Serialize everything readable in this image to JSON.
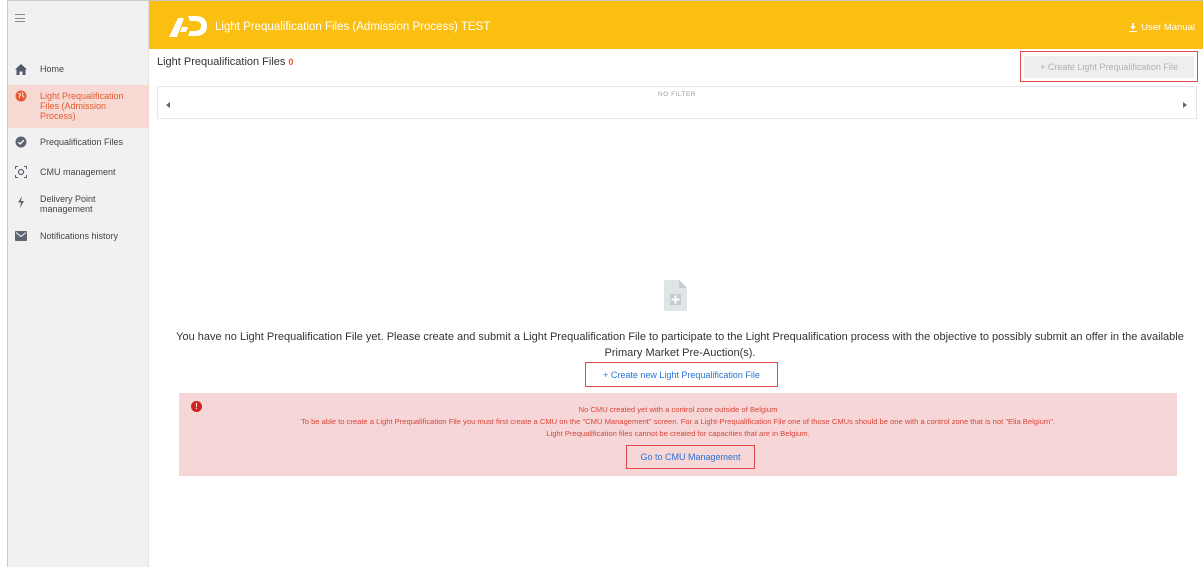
{
  "sidebar": {
    "items": [
      {
        "label": "Home",
        "icon": "home-icon",
        "active": false
      },
      {
        "label": "Light Prequalification Files (Admission Process)",
        "icon": "globe-icon",
        "active": true
      },
      {
        "label": "Prequalification Files",
        "icon": "check-badge-icon",
        "active": false
      },
      {
        "label": "CMU management",
        "icon": "target-icon",
        "active": false
      },
      {
        "label": "Delivery Point management",
        "icon": "lightning-icon",
        "active": false
      },
      {
        "label": "Notifications history",
        "icon": "envelope-icon",
        "active": false
      }
    ]
  },
  "header": {
    "title": "Light Prequalification Files (Admission Process) TEST",
    "user_manual": "User Manual",
    "brand_color": "#fbbf12"
  },
  "main": {
    "page_title": "Light Prequalification Files",
    "count": "0",
    "create_top_button": "+ Create Light Prequalification File",
    "filter_label": "NO FILTER",
    "empty_message": "You have no Light Prequalification File yet. Please create and submit a Light Prequalification File to participate to the Light Prequalification process with the objective to possibly submit an offer in the available Primary Market Pre-Auction(s).",
    "create_new_button": "+ Create new Light Prequalification File"
  },
  "alert": {
    "line1": "No CMU created yet with a control zone outside of Belgium",
    "line2": "To be able to create a Light Prequalification File you must first create a CMU on the \"CMU Management\" screen. For a Light-Prequalification File one of those CMUs should be one with a control zone that is not \"Elia Belgium\".",
    "line3": "Light Prequalification files cannot be created for capacities that are in Belgium.",
    "button": "Go to CMU Management",
    "icon_glyph": "!",
    "background": "#f6d6d6",
    "text_color": "#d9453a"
  },
  "colors": {
    "accent": "#e55a32",
    "link": "#2874d6",
    "highlight_border": "#e0484a"
  }
}
